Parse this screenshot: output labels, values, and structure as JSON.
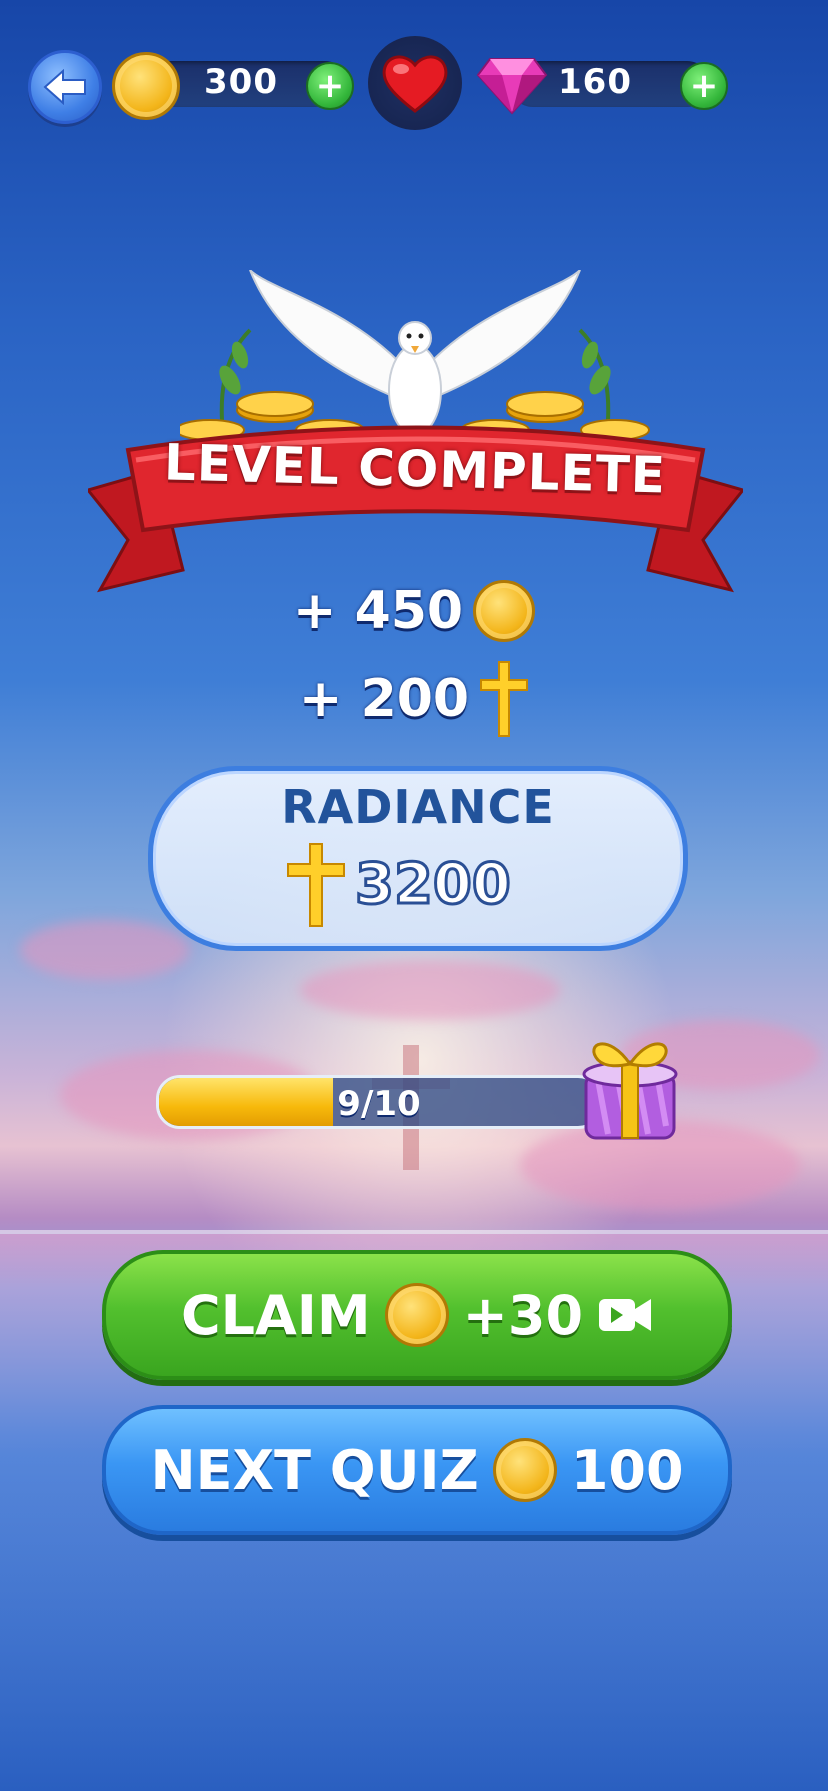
{
  "top_bar": {
    "coins": "300",
    "gems": "160",
    "back_icon": "arrow-left-icon",
    "coin_icon": "coin-icon",
    "heart_icon": "heart-icon",
    "gem_icon": "gem-icon",
    "plus_label": "+"
  },
  "banner": {
    "title": "LEVEL COMPLETE"
  },
  "rewards": {
    "coins_label": "+ 450",
    "faith_label": "+ 200"
  },
  "radiance": {
    "title": "RADIANCE",
    "value": "3200"
  },
  "progress": {
    "current": 9,
    "total": 10,
    "fraction": 0.9,
    "label": "9/10"
  },
  "buttons": {
    "claim_label": "CLAIM",
    "claim_amount": "+30",
    "next_label": "NEXT QUIZ",
    "next_amount": "100"
  },
  "colors": {
    "claim_green": "#52c02e",
    "next_blue": "#3a96f4",
    "banner_red": "#e0262e",
    "gold": "#f3b51a"
  }
}
